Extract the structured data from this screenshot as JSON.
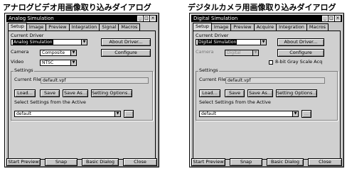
{
  "captions": {
    "left": "アナログビデオ用画像取り込みダイアログ",
    "right": "デジタルカメラ用画像取り込みダイアログ"
  },
  "win1": {
    "title": "Analog Simulation",
    "tabs": [
      "Setup",
      "Image",
      "Preview",
      "Integration",
      "Signal",
      "Macros"
    ],
    "current_driver_label": "Current Driver",
    "driver_value": "Analog Simulation",
    "about_driver": "About Driver...",
    "camera_label": "Camera",
    "camera_value": "Composite",
    "configure": "Configure",
    "video_label": "Video",
    "video_value": "NTSC",
    "settings_label": "Settings",
    "current_file_label": "Current File:",
    "current_file_value": "default.vpf",
    "load": "Load...",
    "save": "Save",
    "save_as": "Save As...",
    "setting_options": "Setting Options...",
    "select_settings_label": "Select Settings from the Active",
    "select_settings_value": "default",
    "browse": "...",
    "start_preview": "Start Preview",
    "snap": "Snap",
    "basic_dialog": "Basic Dialog",
    "close": "Close"
  },
  "win2": {
    "title": "Digital Simulation",
    "tabs": [
      "Setup",
      "Image",
      "Preview",
      "Acquire",
      "Integration",
      "Macros"
    ],
    "current_driver_label": "Current Driver",
    "driver_value": "Digital Simulation",
    "about_driver": "About Driver...",
    "camera_label": "Camera",
    "camera_value": "Digital",
    "configure": "Configure",
    "gray_scale_label": "8-bit Gray Scale Acq",
    "settings_label": "Settings",
    "current_file_label": "Current File:",
    "current_file_value": "default.vpf",
    "load": "Load...",
    "save": "Save",
    "save_as": "Save As...",
    "setting_options": "Setting Options...",
    "select_settings_label": "Select Settings from the Active",
    "select_settings_value": "default",
    "browse": "...",
    "start_preview": "Start Preview",
    "snap": "Snap",
    "basic_dialog": "Basic Dialog",
    "close": "Close"
  },
  "icons": {
    "minimize": "minimize-icon",
    "maximize": "maximize-icon",
    "close": "close-icon",
    "dropdown": "chevron-down-icon"
  }
}
